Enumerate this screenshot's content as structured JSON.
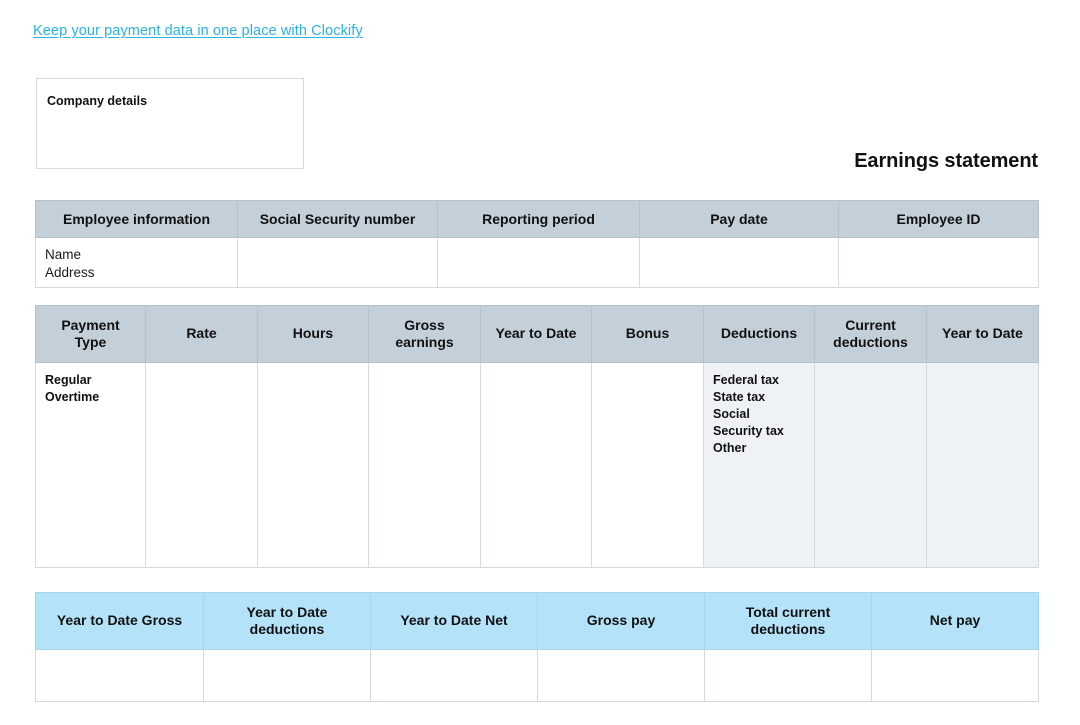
{
  "promo": {
    "link_text": "Keep your payment data in one place with Clockify",
    "link_color": "#29b3e3"
  },
  "company": {
    "label": "Company details"
  },
  "document": {
    "title": "Earnings statement"
  },
  "employee_table": {
    "headers": [
      "Employee information",
      "Social Security number",
      "Reporting period",
      "Pay date",
      "Employee ID"
    ],
    "row": {
      "employee_information": "Name\nAddress",
      "social_security_number": "",
      "reporting_period": "",
      "pay_date": "",
      "employee_id": ""
    }
  },
  "earnings_table": {
    "headers": [
      "Payment\nType",
      "Rate",
      "Hours",
      "Gross\nearnings",
      "Year to Date",
      "Bonus",
      "Deductions",
      "Current\ndeductions",
      "Year to Date"
    ],
    "row": {
      "payment_type": "Regular\nOvertime",
      "rate": "",
      "hours": "",
      "gross_earnings": "",
      "year_to_date": "",
      "bonus": "",
      "deductions": "Federal tax\nState tax\nSocial\nSecurity tax\nOther",
      "current_deductions": "",
      "year_to_date_deductions": ""
    }
  },
  "totals_table": {
    "headers": [
      "Year to Date Gross",
      "Year to Date\ndeductions",
      "Year to Date Net",
      "Gross pay",
      "Total current\ndeductions",
      "Net pay"
    ],
    "row": {
      "year_to_date_gross": "",
      "year_to_date_deductions": "",
      "year_to_date_net": "",
      "gross_pay": "",
      "total_current_deductions": "",
      "net_pay": ""
    }
  },
  "colors": {
    "header_gray_blue": "#c3d0d9",
    "header_light_blue": "#b4e2f8",
    "tinted_cell": "#eef2f5",
    "border": "#cfd8dc",
    "accent_link": "#29b3e3"
  }
}
